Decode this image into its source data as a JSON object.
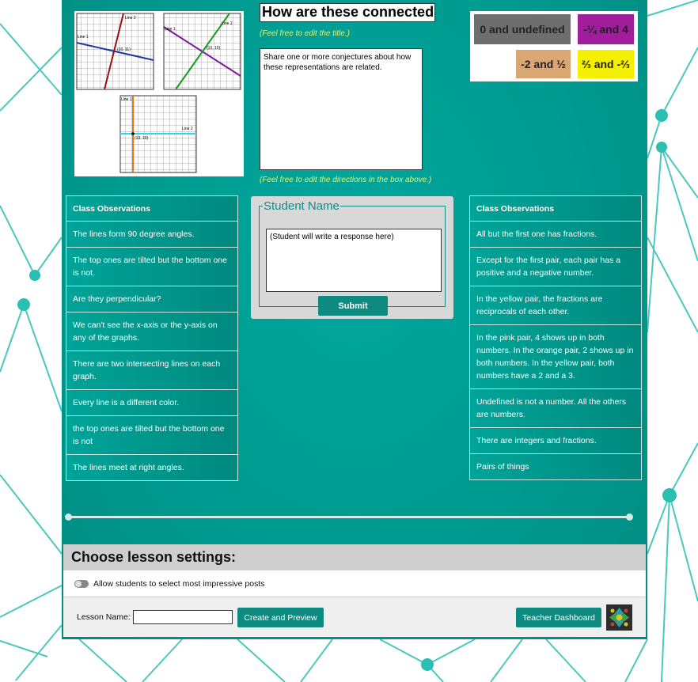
{
  "title": "How are these connected?",
  "title_hint": "(Feel free to edit the title.)",
  "directions": "Share one or more conjectures about how these representations are related.",
  "directions_hint": "(Feel free to edit the directions in the box above.)",
  "graphs": {
    "g1": {
      "line1": "Line 1",
      "line2": "Line 2",
      "point": "(10, 11)"
    },
    "g2": {
      "line1": "Line 1",
      "line2": "Line 2",
      "point": "(10, 15)"
    },
    "g3": {
      "line1": "Line 1",
      "line2": "Line 2",
      "point": "(13, 10)"
    }
  },
  "pairs": [
    {
      "label": "0 and undefined",
      "color": "#6e6e6e"
    },
    {
      "label": "-¼ and 4",
      "color": "#a01e9c"
    },
    {
      "label": "-2 and ½",
      "color": "#d9a773"
    },
    {
      "label": "⅔ and -⅔",
      "color": "#f5ef00"
    }
  ],
  "left_observations": {
    "header": "Class Observations",
    "items": [
      "The lines form 90 degree angles.",
      "The top ones are tilted but the bottom one is not.",
      "Are they perpendicular?",
      "We can't see the x-axis or the y-axis on any of the graphs.",
      "There are two intersecting lines on each graph.",
      "Every line is a different color.",
      "the top ones are tilted but the bottom one is not",
      "The lines meet at right angles."
    ]
  },
  "right_observations": {
    "header": "Class Observations",
    "items": [
      "All but the first one has fractions.",
      "Except for the first pair, each pair has a positive and a negative number.",
      "In the yellow pair, the fractions are reciprocals of each other.",
      "In the pink pair, 4 shows up in both numbers. In the orange pair, 2 shows up in both numbers. In the yellow pair, both numbers have a 2 and a 3.",
      "Undefined is not a number. All the others are numbers.",
      "There are integers and fractions.",
      "Pairs of things"
    ]
  },
  "student": {
    "legend": "Student Name",
    "response_placeholder": "(Student will write a response here)",
    "submit": "Submit"
  },
  "settings": {
    "heading": "Choose lesson settings:",
    "toggle_label": "Allow students to select most impressive posts",
    "lesson_name_label": "Lesson Name:",
    "lesson_name_value": "",
    "create_button": "Create and Preview",
    "dashboard_button": "Teacher Dashboard"
  },
  "colors": {
    "teal": "#009b91",
    "button": "#0e8a81"
  }
}
